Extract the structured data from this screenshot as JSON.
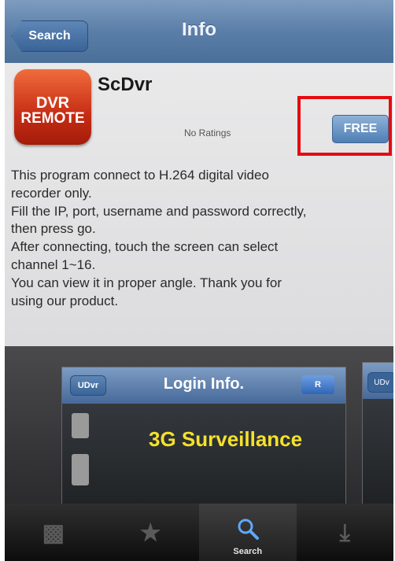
{
  "navbar": {
    "back_label": "Search",
    "title": "Info"
  },
  "app": {
    "icon_line1": "DVR",
    "icon_line2": "REMOTE",
    "name": "ScDvr",
    "ratings": "No Ratings",
    "price": "FREE"
  },
  "description": [
    "This program connect to H.264 digital video",
    "recorder only.",
    "Fill the IP, port, username and password correctly,",
    "then press go.",
    "After connecting, touch the screen can select",
    "channel 1~16.",
    "You can view it in proper angle. Thank you for",
    "using our product."
  ],
  "screenshot": {
    "back_label": "UDvr",
    "title": "Login Info.",
    "right_button": "R",
    "headline": "3G Surveillance",
    "peek_button": "UDv"
  },
  "tabbar": {
    "items": [
      {
        "icon": "featured-icon",
        "label": "",
        "active": false
      },
      {
        "icon": "star-icon",
        "label": "",
        "active": false
      },
      {
        "icon": "search-icon",
        "label": "Search",
        "active": true
      },
      {
        "icon": "updates-icon",
        "label": "",
        "active": false
      }
    ]
  },
  "colors": {
    "highlight": "#e40c12",
    "nav": "#5a7ea8",
    "price": "#4f7fb4"
  }
}
